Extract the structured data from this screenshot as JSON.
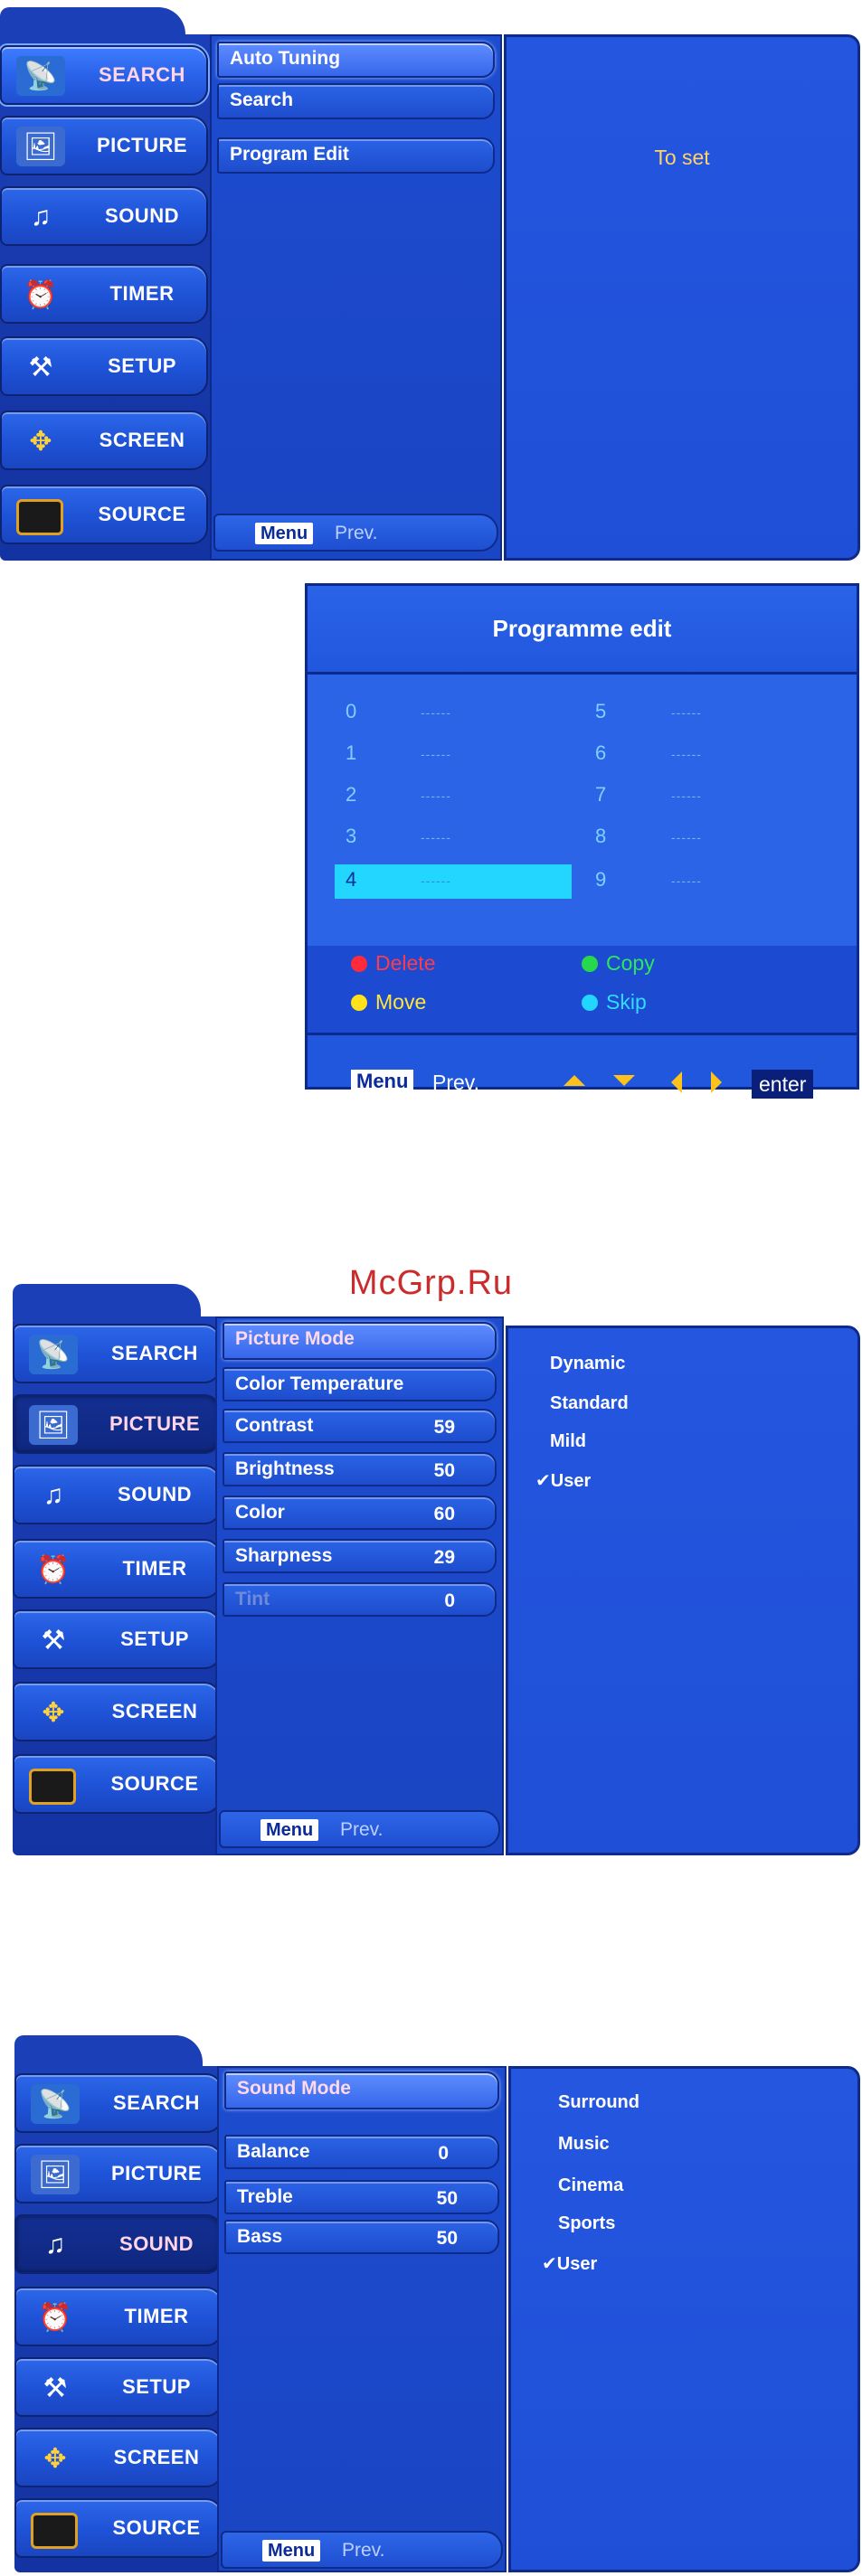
{
  "sidebar_labels": [
    "SEARCH",
    "PICTURE",
    "SOUND",
    "TIMER",
    "SETUP",
    "SCREEN",
    "SOURCE"
  ],
  "footer": {
    "menu_key": "Menu",
    "prev_label": "Prev."
  },
  "search_menu": {
    "items": [
      "Auto Tuning",
      "Search",
      "Program Edit"
    ],
    "info": "To set"
  },
  "programme_edit": {
    "title": "Programme edit",
    "channels": [
      {
        "num": "0",
        "name": "------"
      },
      {
        "num": "1",
        "name": "------"
      },
      {
        "num": "2",
        "name": "------"
      },
      {
        "num": "3",
        "name": "------"
      },
      {
        "num": "4",
        "name": "------"
      },
      {
        "num": "5",
        "name": "------"
      },
      {
        "num": "6",
        "name": "------"
      },
      {
        "num": "7",
        "name": "------"
      },
      {
        "num": "8",
        "name": "------"
      },
      {
        "num": "9",
        "name": "------"
      }
    ],
    "legend": {
      "delete": "Delete",
      "copy": "Copy",
      "move": "Move",
      "skip": "Skip"
    },
    "footer": {
      "menu_key": "Menu",
      "prev_label": "Prev.",
      "enter_label": "enter"
    },
    "colors": {
      "delete": "#ff2a3a",
      "copy": "#27d94a",
      "move": "#ffe21a",
      "skip": "#22d6ff"
    }
  },
  "watermark": "McGrp.Ru",
  "picture_menu": {
    "items": [
      {
        "label": "Picture Mode",
        "value": ""
      },
      {
        "label": "Color Temperature",
        "value": ""
      },
      {
        "label": "Contrast",
        "value": "59"
      },
      {
        "label": "Brightness",
        "value": "50"
      },
      {
        "label": "Color",
        "value": "60"
      },
      {
        "label": "Sharpness",
        "value": "29"
      },
      {
        "label": "Tint",
        "value": "0"
      }
    ],
    "options": [
      "Dynamic",
      "Standard",
      "Mild",
      "✔User"
    ]
  },
  "sound_menu": {
    "items": [
      {
        "label": "Sound Mode",
        "value": ""
      },
      {
        "label": "Balance",
        "value": "0"
      },
      {
        "label": "Treble",
        "value": "50"
      },
      {
        "label": "Bass",
        "value": "50"
      }
    ],
    "options": [
      "Surround",
      "Music",
      "Cinema",
      "Sports",
      "✔User"
    ]
  }
}
